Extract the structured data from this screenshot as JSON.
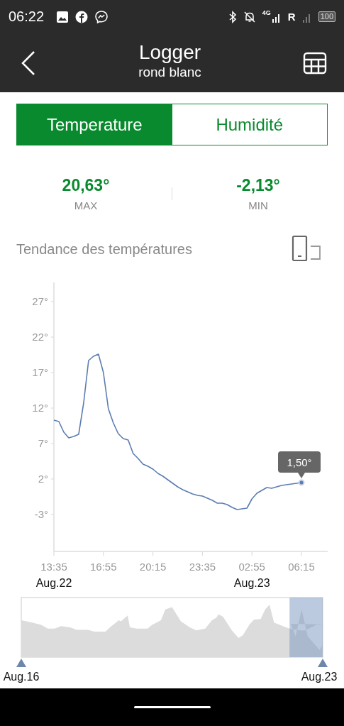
{
  "status_bar": {
    "time": "06:22",
    "network": "4G",
    "roaming": "R",
    "battery": "100"
  },
  "header": {
    "title": "Logger",
    "subtitle": "rond blanc"
  },
  "tabs": [
    {
      "label": "Temperature",
      "selected": true
    },
    {
      "label": "Humidité",
      "selected": false
    }
  ],
  "stats": [
    {
      "value": "20,63°",
      "label": "MAX"
    },
    {
      "value": "-2,13°",
      "label": "MIN"
    }
  ],
  "trend": {
    "title": "Tendance des températures",
    "chart_data": {
      "type": "line",
      "categories": [
        "13:35",
        null,
        null,
        null,
        null,
        null,
        null,
        null,
        null,
        null,
        "16:55",
        null,
        null,
        null,
        null,
        null,
        null,
        null,
        null,
        null,
        "20:15",
        null,
        null,
        null,
        null,
        null,
        null,
        null,
        null,
        null,
        "23:35",
        null,
        null,
        null,
        null,
        null,
        null,
        null,
        null,
        null,
        "02:55",
        null,
        null,
        null,
        null,
        null,
        null,
        null,
        null,
        null,
        "06:15"
      ],
      "series": [
        {
          "color": "#5b7db1",
          "values": [
            10.3,
            10.1,
            8.6,
            7.8,
            8.0,
            8.3,
            12.7,
            18.7,
            19.3,
            19.6,
            17.0,
            11.9,
            9.9,
            8.4,
            7.7,
            7.5,
            5.6,
            4.9,
            4.1,
            3.8,
            3.4,
            2.8,
            2.4,
            1.9,
            1.4,
            0.9,
            0.5,
            0.2,
            -0.1,
            -0.3,
            -0.4,
            -0.7,
            -1.0,
            -1.4,
            -1.4,
            -1.6,
            -2.0,
            -2.3,
            -2.2,
            -2.1,
            -0.8,
            0,
            0.4,
            0.8,
            0.7,
            0.9,
            1.1,
            1.2,
            1.3,
            1.4,
            1.5
          ]
        }
      ],
      "ylim": [
        -8.2,
        29.7
      ],
      "yticks": [
        {
          "value": 27,
          "label": "27°"
        },
        {
          "value": 22,
          "label": "22°"
        },
        {
          "value": 17,
          "label": "17°"
        },
        {
          "value": 12,
          "label": "12°"
        },
        {
          "value": 7,
          "label": "7°"
        },
        {
          "value": 2,
          "label": "2°"
        },
        {
          "value": -3,
          "label": "-3°"
        }
      ],
      "annotations": [
        {
          "x": "06:15",
          "y": 1.5,
          "text": "1,50°"
        }
      ]
    },
    "dates": [
      {
        "label": "Aug.22"
      },
      {
        "label": "Aug.23"
      }
    ]
  },
  "navigator": {
    "start_label": "Aug.16",
    "end_label": "Aug.23",
    "level": 0.11
  }
}
